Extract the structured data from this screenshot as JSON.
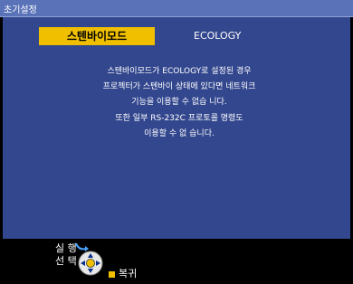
{
  "window": {
    "title": "초기설정"
  },
  "setting": {
    "label": "스텐바이모드",
    "value": "ECOLOGY"
  },
  "message": {
    "lines": [
      "스텐바이모드가 ECOLOGY로 설정된 경우",
      "프로젝터가 스텐바이 상태에 있다면 네트워크",
      "기능을 이용할 수 없습 니다.",
      "또한 일부 RS-232C 프로토콜 명령도",
      "이용할 수 없 습니다."
    ]
  },
  "footer": {
    "exec_label": "실 행",
    "select_label": "선 택",
    "back_label": "복귀",
    "icons": [
      "enter-curve-icon",
      "dpad-icon",
      "yellow-square-icon"
    ],
    "colors": {
      "title_bar": "#5a73b8",
      "panel": "#33478e",
      "highlight": "#f0c000"
    }
  }
}
